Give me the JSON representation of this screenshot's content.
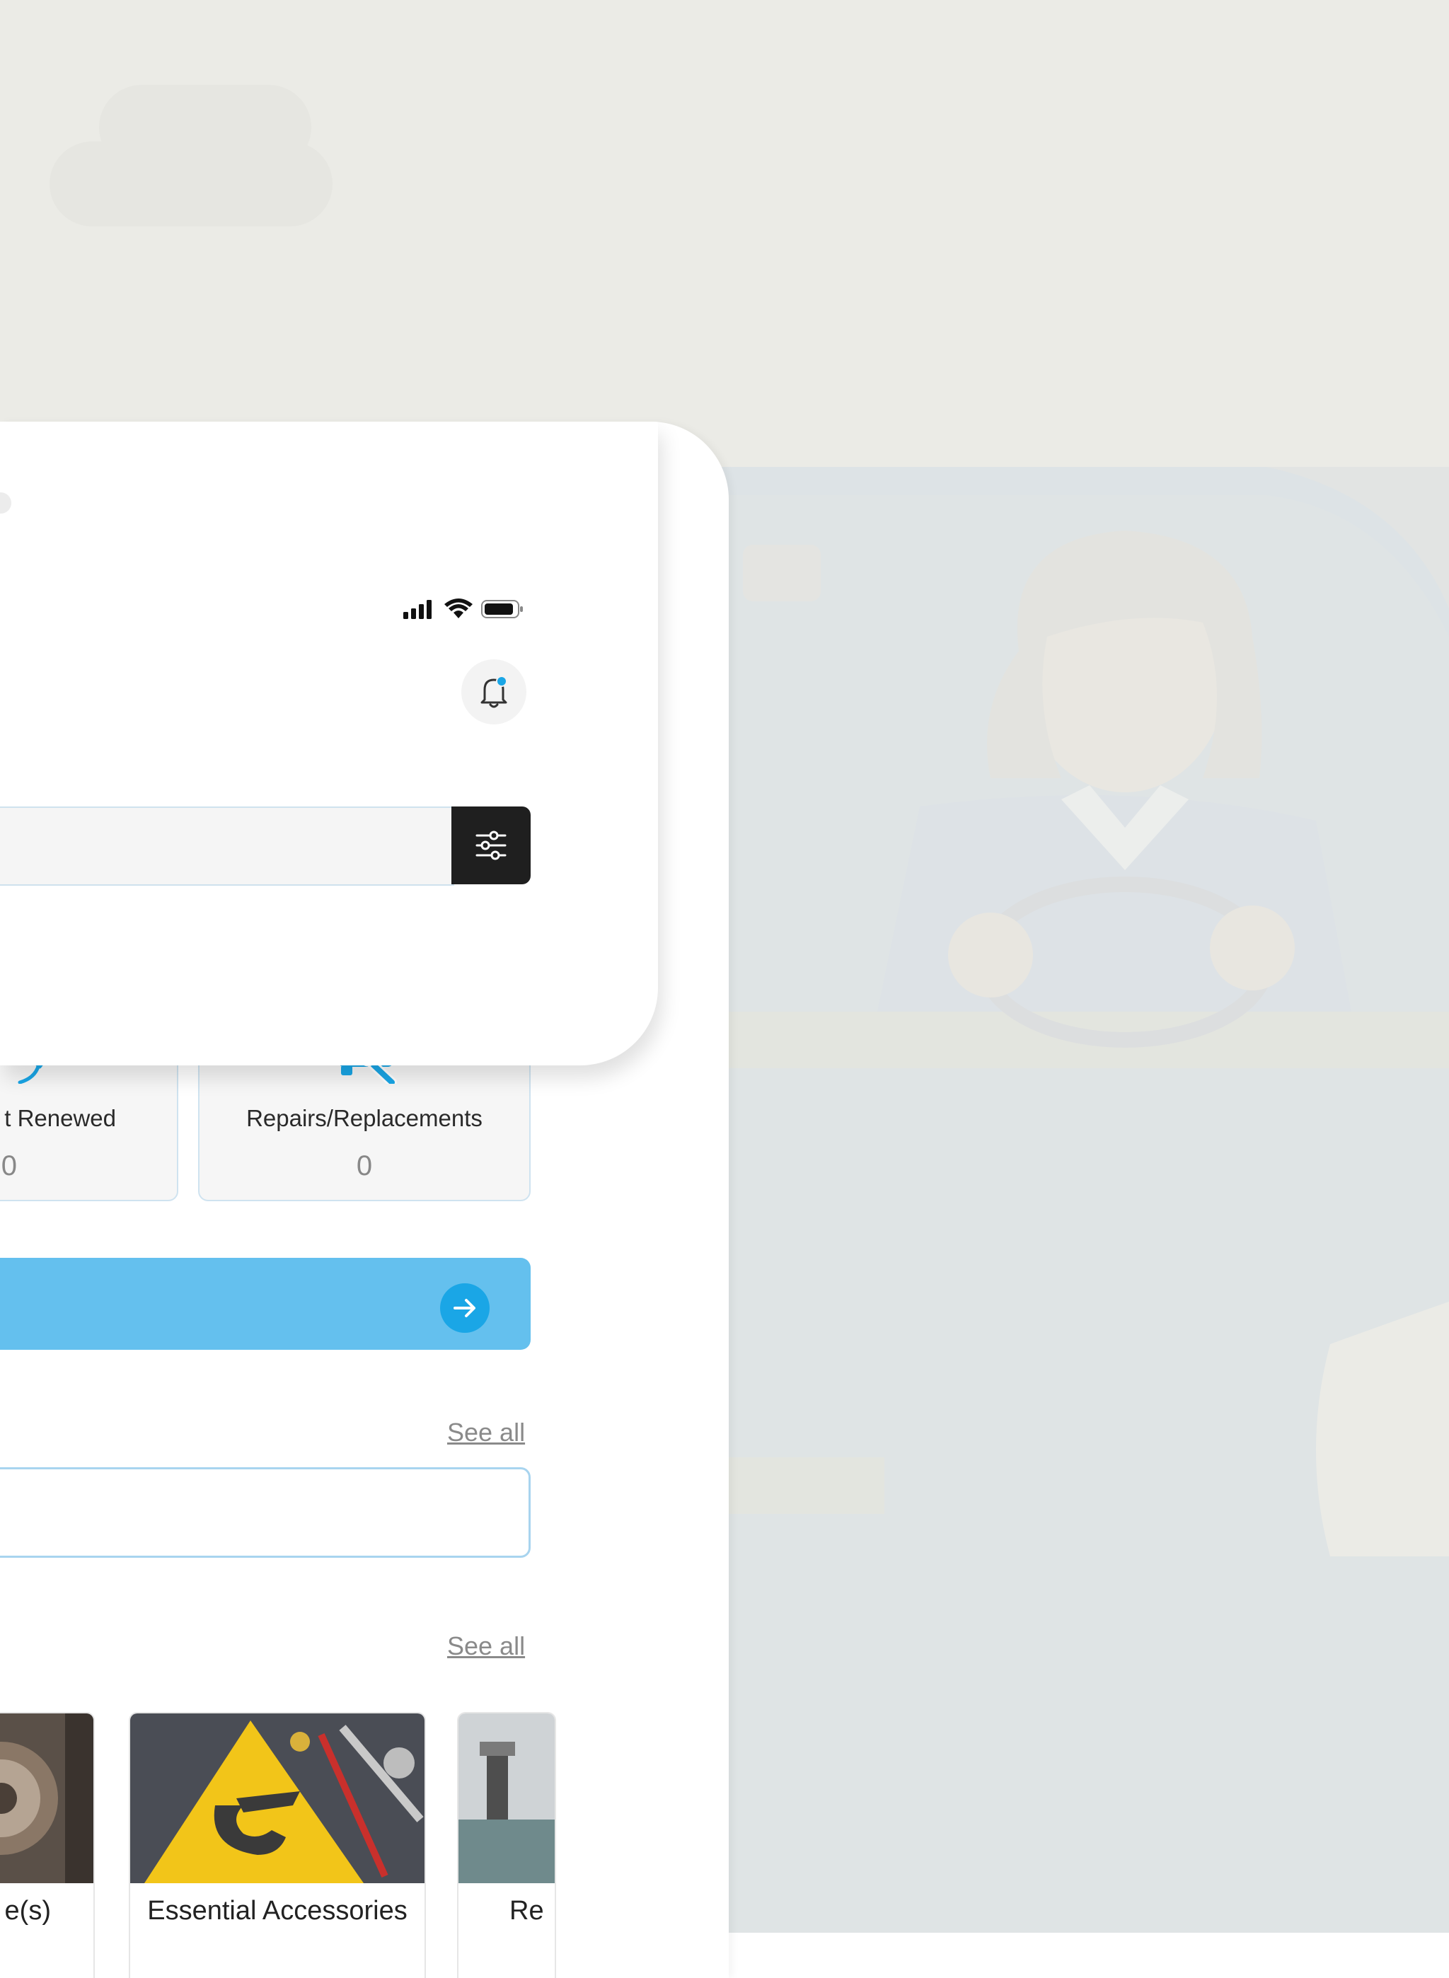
{
  "colors": {
    "accent": "#64c0ee",
    "accent_dark": "#1aa6e6",
    "filter_button": "#1f1f1f",
    "card_border": "#cfe3f0",
    "background": "#ebebe6"
  },
  "status_bar": {
    "icons": [
      "signal-icon",
      "wifi-icon",
      "battery-icon"
    ]
  },
  "header": {
    "notification_icon": "bell-icon"
  },
  "search": {
    "placeholder": "",
    "filter_icon": "sliders-icon"
  },
  "stats": [
    {
      "label": "t Renewed",
      "value": "0",
      "icon": "refresh-icon"
    },
    {
      "label": "Repairs/Replacements",
      "value": "0",
      "icon": "car-wrench-icon"
    }
  ],
  "cta": {
    "icon": "arrow-right-icon"
  },
  "sections": {
    "see_all_1": "See all",
    "see_all_2": "See all"
  },
  "categories": [
    {
      "label": "e(s)"
    },
    {
      "label": "Essential Accessories"
    },
    {
      "label": "Re"
    }
  ]
}
